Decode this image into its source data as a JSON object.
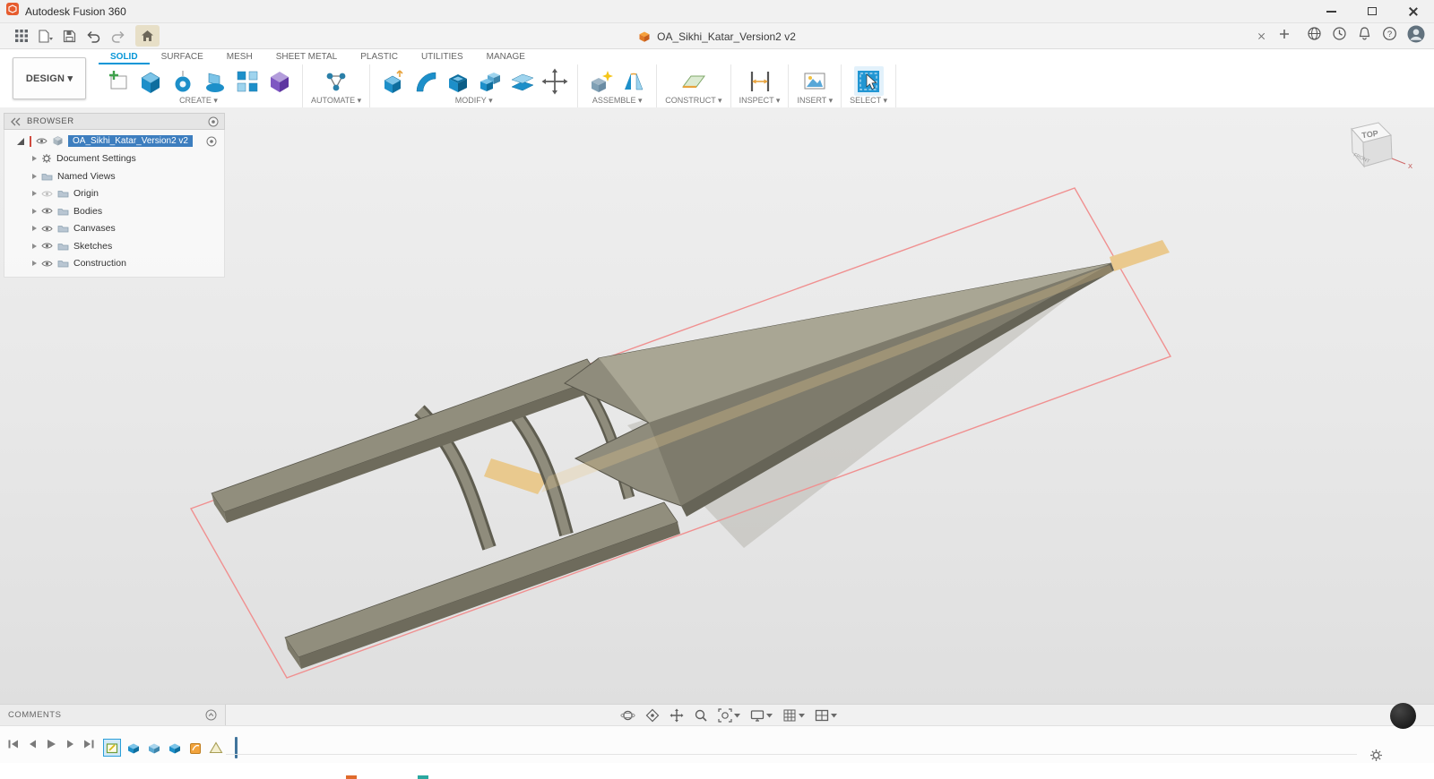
{
  "titlebar": {
    "app_title": "Autodesk Fusion 360"
  },
  "toolbar": {
    "document_tab": "OA_Sikhi_Katar_Version2 v2"
  },
  "ribbon": {
    "workspace_label": "DESIGN ▾",
    "tabs": [
      {
        "label": "SOLID",
        "active": true
      },
      {
        "label": "SURFACE",
        "active": false
      },
      {
        "label": "MESH",
        "active": false
      },
      {
        "label": "SHEET METAL",
        "active": false
      },
      {
        "label": "PLASTIC",
        "active": false
      },
      {
        "label": "UTILITIES",
        "active": false
      },
      {
        "label": "MANAGE",
        "active": false
      }
    ],
    "groups": [
      {
        "label": "CREATE ▾"
      },
      {
        "label": "AUTOMATE ▾"
      },
      {
        "label": "MODIFY ▾"
      },
      {
        "label": "ASSEMBLE ▾"
      },
      {
        "label": "CONSTRUCT ▾"
      },
      {
        "label": "INSPECT ▾"
      },
      {
        "label": "INSERT ▾"
      },
      {
        "label": "SELECT ▾"
      }
    ]
  },
  "browser": {
    "header_label": "BROWSER",
    "root_label": "OA_Sikhi_Katar_Version2 v2",
    "items": [
      {
        "label": "Document Settings"
      },
      {
        "label": "Named Views"
      },
      {
        "label": "Origin"
      },
      {
        "label": "Bodies"
      },
      {
        "label": "Canvases"
      },
      {
        "label": "Sketches"
      },
      {
        "label": "Construction"
      }
    ]
  },
  "viewcube": {
    "top_label": "TOP",
    "front_label": "FRONT",
    "axis_x_label": "X"
  },
  "comments": {
    "label": "COMMENTS"
  },
  "icons": {
    "help_glyph": "?"
  },
  "colors": {
    "accent_blue": "#0696d7",
    "selection_blue": "#3d7ebf",
    "sketch_pink": "#f09090",
    "sketch_tan": "#e9c98e",
    "model_olive": "#8f8c7c",
    "canvas_gray": "#e9e9e9"
  }
}
